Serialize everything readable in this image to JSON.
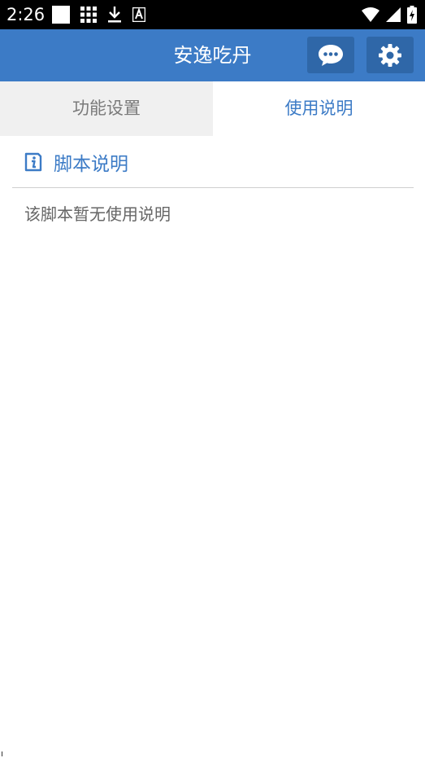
{
  "status_bar": {
    "time": "2:26",
    "left_icons": [
      "blank-app-icon",
      "grid-app-icon",
      "download-icon",
      "a-app-icon"
    ],
    "right_icons": [
      "wifi-icon",
      "signal-icon",
      "battery-charging-icon"
    ]
  },
  "app_bar": {
    "title": "安逸吃丹",
    "chat_icon": "chat-bubble-icon",
    "settings_icon": "gear-icon",
    "color": "#3c7bc6",
    "button_color": "#2f67a8"
  },
  "tabs": [
    {
      "label": "功能设置",
      "active": false
    },
    {
      "label": "使用说明",
      "active": true
    }
  ],
  "usage": {
    "section_icon": "info-doc-icon",
    "section_title": "脚本说明",
    "body_text": "该脚本暂无使用说明"
  }
}
